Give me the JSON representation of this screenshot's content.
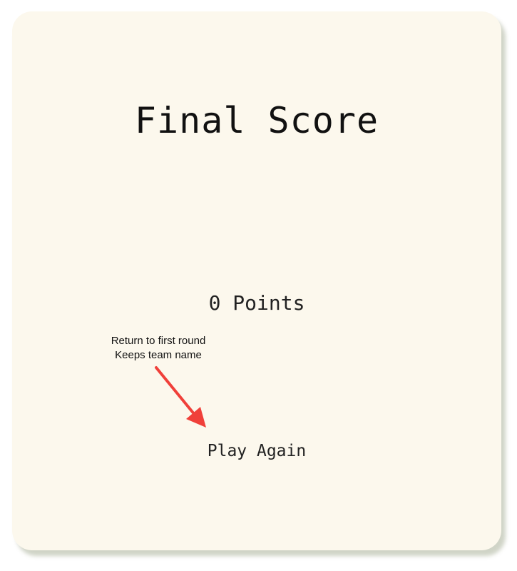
{
  "final_score": {
    "title": "Final Score",
    "points_text": "0 Points",
    "play_again_label": "Play Again"
  },
  "annotation": {
    "line1": "Return to first round",
    "line2": "Keeps team name",
    "arrow_color": "#f0403a"
  },
  "colors": {
    "card_background": "#fcf8ed",
    "text": "#111111"
  }
}
